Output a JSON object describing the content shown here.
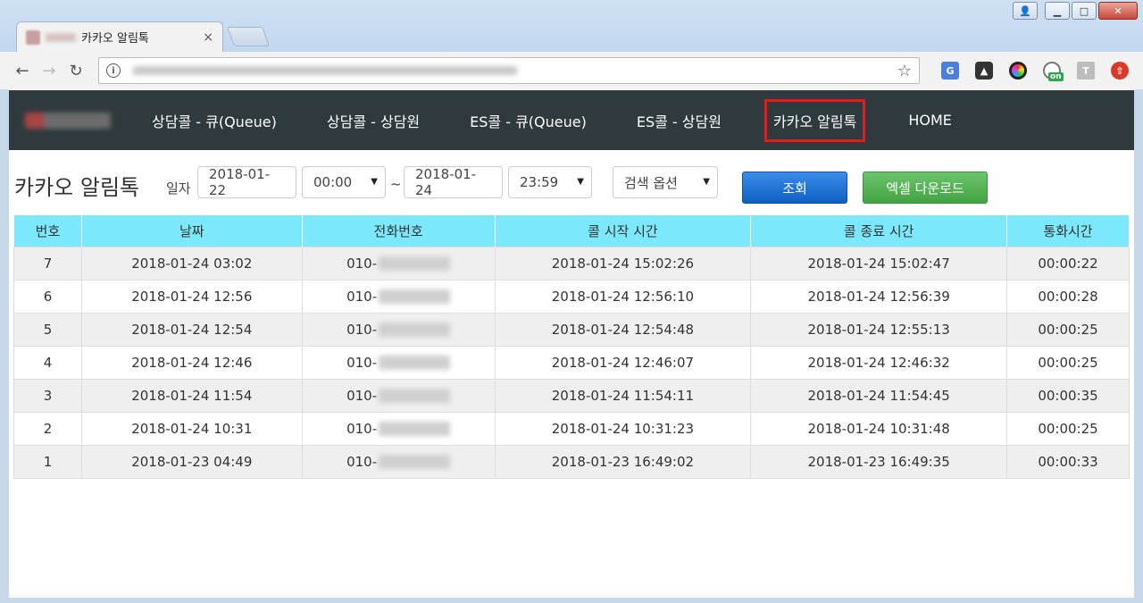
{
  "browser": {
    "tab_title": "카카오 알림톡",
    "tab_close": "×",
    "ext_on_label": "on",
    "ext_t_label": "T"
  },
  "site_nav": {
    "items": [
      {
        "label": "상담콜 - 큐(Queue)"
      },
      {
        "label": "상담콜 - 상담원"
      },
      {
        "label": "ES콜 - 큐(Queue)"
      },
      {
        "label": "ES콜 - 상담원"
      },
      {
        "label": "카카오 알림톡",
        "active": true
      },
      {
        "label": "HOME"
      }
    ]
  },
  "filters": {
    "page_title": "카카오 알림톡",
    "date_label": "일자",
    "start_date": "2018-01-22",
    "start_time": "00:00",
    "separator": "~",
    "end_date": "2018-01-24",
    "end_time": "23:59",
    "search_option": "검색 옵션",
    "search_button": "조회",
    "excel_button": "엑셀 다운로드"
  },
  "table": {
    "headers": [
      "번호",
      "날짜",
      "전화번호",
      "콜 시작 시간",
      "콜 종료 시간",
      "통화시간"
    ],
    "rows": [
      {
        "no": "7",
        "date": "2018-01-24 03:02",
        "phone": "010-",
        "start": "2018-01-24 15:02:26",
        "end": "2018-01-24 15:02:47",
        "duration": "00:00:22"
      },
      {
        "no": "6",
        "date": "2018-01-24 12:56",
        "phone": "010-",
        "start": "2018-01-24 12:56:10",
        "end": "2018-01-24 12:56:39",
        "duration": "00:00:28"
      },
      {
        "no": "5",
        "date": "2018-01-24 12:54",
        "phone": "010-",
        "start": "2018-01-24 12:54:48",
        "end": "2018-01-24 12:55:13",
        "duration": "00:00:25"
      },
      {
        "no": "4",
        "date": "2018-01-24 12:46",
        "phone": "010-",
        "start": "2018-01-24 12:46:07",
        "end": "2018-01-24 12:46:32",
        "duration": "00:00:25"
      },
      {
        "no": "3",
        "date": "2018-01-24 11:54",
        "phone": "010-",
        "start": "2018-01-24 11:54:11",
        "end": "2018-01-24 11:54:45",
        "duration": "00:00:35"
      },
      {
        "no": "2",
        "date": "2018-01-24 10:31",
        "phone": "010-",
        "start": "2018-01-24 10:31:23",
        "end": "2018-01-24 10:31:48",
        "duration": "00:00:25"
      },
      {
        "no": "1",
        "date": "2018-01-23 04:49",
        "phone": "010-",
        "start": "2018-01-23 16:49:02",
        "end": "2018-01-23 16:49:35",
        "duration": "00:00:33"
      }
    ]
  },
  "colors": {
    "nav_bg": "#2f3a3e",
    "active_outline": "#e21c1c",
    "table_header_bg": "#7be8fb",
    "search_button_bg": "#1a6fd6",
    "excel_button_bg": "#4fb04f"
  }
}
